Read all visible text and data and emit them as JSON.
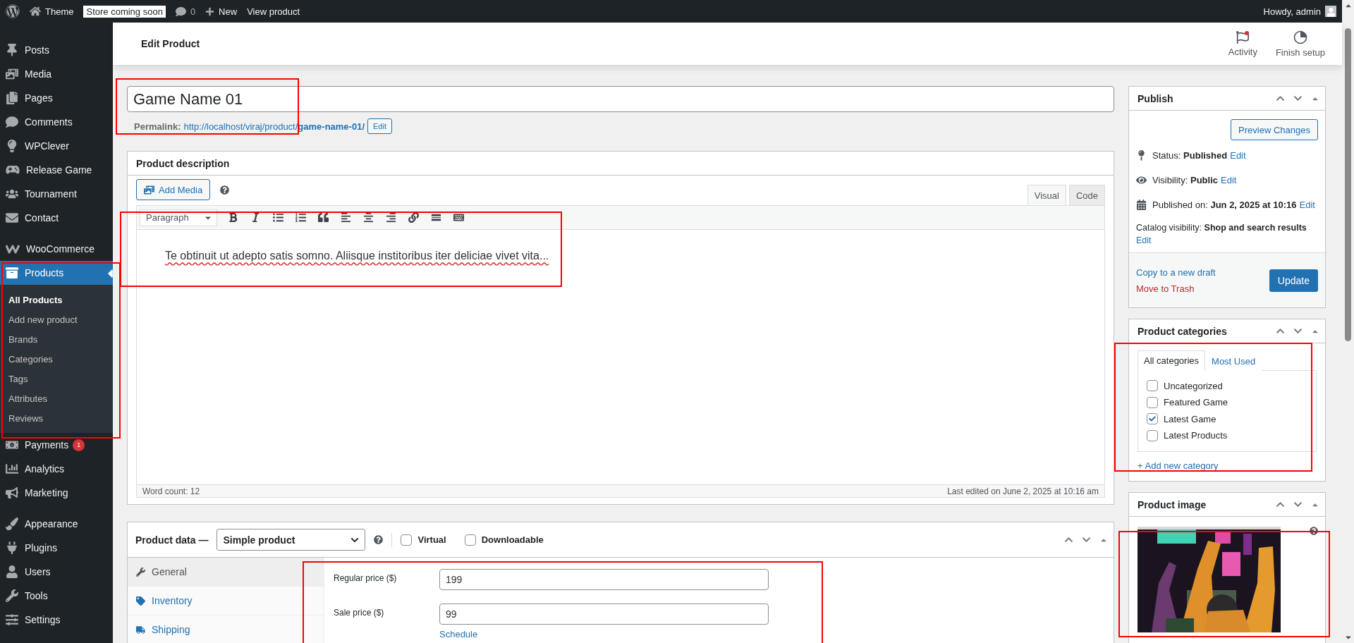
{
  "admin_bar": {
    "site_name": "Theme",
    "store_badge": "Store coming soon",
    "comments_count": "0",
    "new_label": "New",
    "view_link": "View product",
    "greeting": "Howdy, admin"
  },
  "header": {
    "title": "Edit Product",
    "actions": [
      {
        "kind": "activity",
        "label": "Activity",
        "notification": true
      },
      {
        "kind": "setup",
        "label": "Finish setup",
        "notification": false
      }
    ]
  },
  "sidebar": {
    "groups": [
      [
        {
          "label": "Posts",
          "selected": false
        },
        {
          "label": "Media",
          "selected": false
        },
        {
          "label": "Pages",
          "selected": false
        },
        {
          "label": "Comments",
          "selected": false
        },
        {
          "label": "WPClever",
          "selected": false
        },
        {
          "label": "Release Game",
          "selected": false
        },
        {
          "label": "Tournament",
          "selected": false
        },
        {
          "label": "Contact",
          "selected": false
        }
      ],
      [
        {
          "label": "WooCommerce",
          "selected": false
        },
        {
          "label": "Products",
          "selected": true,
          "submenu": [
            {
              "label": "All Products",
              "selected": true
            },
            {
              "label": "Add new product",
              "selected": false
            },
            {
              "label": "Brands",
              "selected": false
            },
            {
              "label": "Categories",
              "selected": false
            },
            {
              "label": "Tags",
              "selected": false
            },
            {
              "label": "Attributes",
              "selected": false
            },
            {
              "label": "Reviews",
              "selected": false
            }
          ]
        },
        {
          "label": "Payments",
          "selected": false,
          "badge": "1"
        },
        {
          "label": "Analytics",
          "selected": false
        },
        {
          "label": "Marketing",
          "selected": false
        }
      ],
      [
        {
          "label": "Appearance",
          "selected": false
        },
        {
          "label": "Plugins",
          "selected": false
        },
        {
          "label": "Users",
          "selected": false
        },
        {
          "label": "Tools",
          "selected": false
        },
        {
          "label": "Settings",
          "selected": false
        }
      ]
    ]
  },
  "title_field": {
    "value": "Game Name 01"
  },
  "permalink": {
    "label": "Permalink:",
    "url_base": "http://localhost/viraj/product/",
    "slug": "game-name-01/",
    "edit_button": "Edit"
  },
  "description": {
    "title": "Product description",
    "add_media": "Add Media",
    "tabs": [
      {
        "label": "Visual",
        "selected": true
      },
      {
        "label": "Code",
        "selected": false
      }
    ],
    "format": "Paragraph",
    "content": "Te obtinuit ut adepto satis somno. Aliisque institoribus iter deliciae vivet vita...",
    "word_count": "Word count: 12",
    "last_edited": "Last edited on June 2, 2025 at 10:16 am"
  },
  "product_data": {
    "title": "Product data —",
    "type": "Simple product",
    "options": [
      {
        "label": "Virtual",
        "checked": false
      },
      {
        "label": "Downloadable",
        "checked": false
      }
    ],
    "tabs": [
      {
        "label": "General",
        "selected": true
      },
      {
        "label": "Inventory",
        "selected": false
      },
      {
        "label": "Shipping",
        "selected": false
      }
    ],
    "fields": [
      {
        "label": "Regular price ($)",
        "value": "199"
      },
      {
        "label": "Sale price ($)",
        "value": "99",
        "link": "Schedule"
      }
    ]
  },
  "publish": {
    "title": "Publish",
    "preview_button": "Preview Changes",
    "rows": [
      {
        "kind": "meta",
        "label": "Status:",
        "value": "Published",
        "link": "Edit"
      },
      {
        "kind": "meta",
        "label": "Visibility:",
        "value": "Public",
        "link": "Edit"
      },
      {
        "kind": "meta",
        "label": "Published on:",
        "value": "Jun 2, 2025 at 10:16",
        "link": "Edit"
      },
      {
        "kind": "plain",
        "label": "Catalog visibility:",
        "value": "Shop and search results",
        "link": "Edit"
      }
    ],
    "copy_link": "Copy to a new draft",
    "trash_link": "Move to Trash",
    "update_button": "Update"
  },
  "categories": {
    "title": "Product categories",
    "tabs": [
      {
        "label": "All categories",
        "selected": true
      },
      {
        "label": "Most Used",
        "selected": false
      }
    ],
    "items": [
      {
        "label": "Uncategorized",
        "checked": false
      },
      {
        "label": "Featured Game",
        "checked": false
      },
      {
        "label": "Latest Game",
        "checked": true
      },
      {
        "label": "Latest Products",
        "checked": false
      }
    ],
    "add_link": "+ Add new category"
  },
  "product_image": {
    "title": "Product image"
  }
}
